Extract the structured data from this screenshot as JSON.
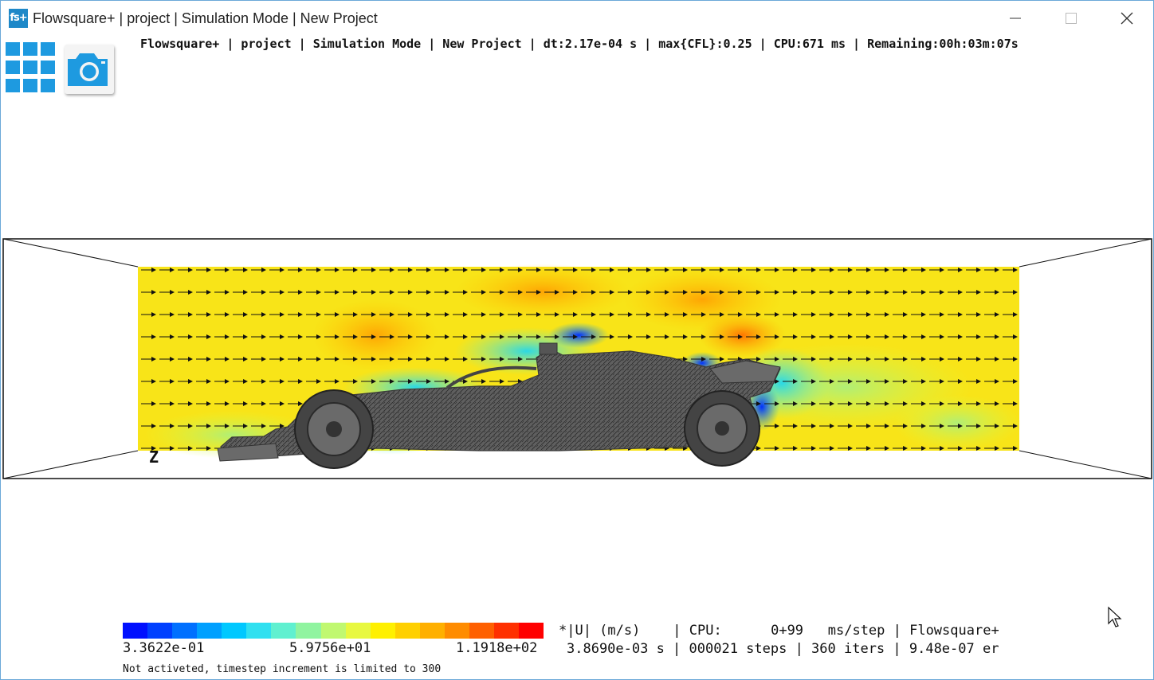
{
  "window": {
    "app_icon": "fs+",
    "title": "Flowsquare+ | project | Simulation Mode | New Project"
  },
  "toolbar": {
    "icons": [
      "grid-menu-icon",
      "camera-icon"
    ]
  },
  "status_bar": {
    "text": "Flowsquare+ | project | Simulation Mode | New Project | dt:2.17e-04 s | max{CFL}:0.25 | CPU:671 ms | Remaining:00h:03m:07s"
  },
  "viewport": {
    "axis_label": "Z"
  },
  "colors": {
    "accent": "#1e9ae0",
    "car": "#5f5f5f"
  },
  "legend": {
    "min": "3.3622e-01",
    "mid": "5.9756e+01",
    "max": "1.1918e+02",
    "colors": [
      "#0010ff",
      "#0040ff",
      "#0070ff",
      "#00a0ff",
      "#00c8ff",
      "#30e0f0",
      "#60f0d0",
      "#90f4a0",
      "#c0f870",
      "#e8f840",
      "#fff000",
      "#ffd000",
      "#ffb000",
      "#ff8c00",
      "#ff6000",
      "#ff3000",
      "#ff0000"
    ]
  },
  "info": {
    "line1": "*|U| (m/s)    | CPU:      0+99   ms/step | Flowsquare+",
    "line2": "3.8690e-03 s | 000021 steps | 360 iters | 9.48e-07 er"
  },
  "note": "Not activeted, timestep increment is limited to 300"
}
